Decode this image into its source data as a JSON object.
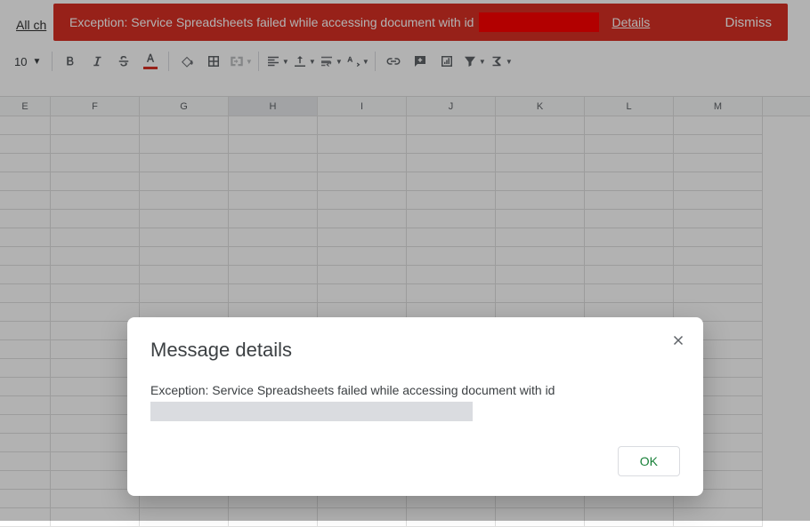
{
  "banner": {
    "message": "Exception: Service Spreadsheets failed while accessing document with id",
    "details_label": "Details",
    "dismiss_label": "Dismiss"
  },
  "allchanges_label": "All ch",
  "toolbar": {
    "font_size": "10"
  },
  "columns": [
    "E",
    "F",
    "G",
    "H",
    "I",
    "J",
    "K",
    "L",
    "M"
  ],
  "selected_column": "H",
  "modal": {
    "title": "Message details",
    "body": "Exception: Service Spreadsheets failed while accessing document with id",
    "ok_label": "OK"
  }
}
